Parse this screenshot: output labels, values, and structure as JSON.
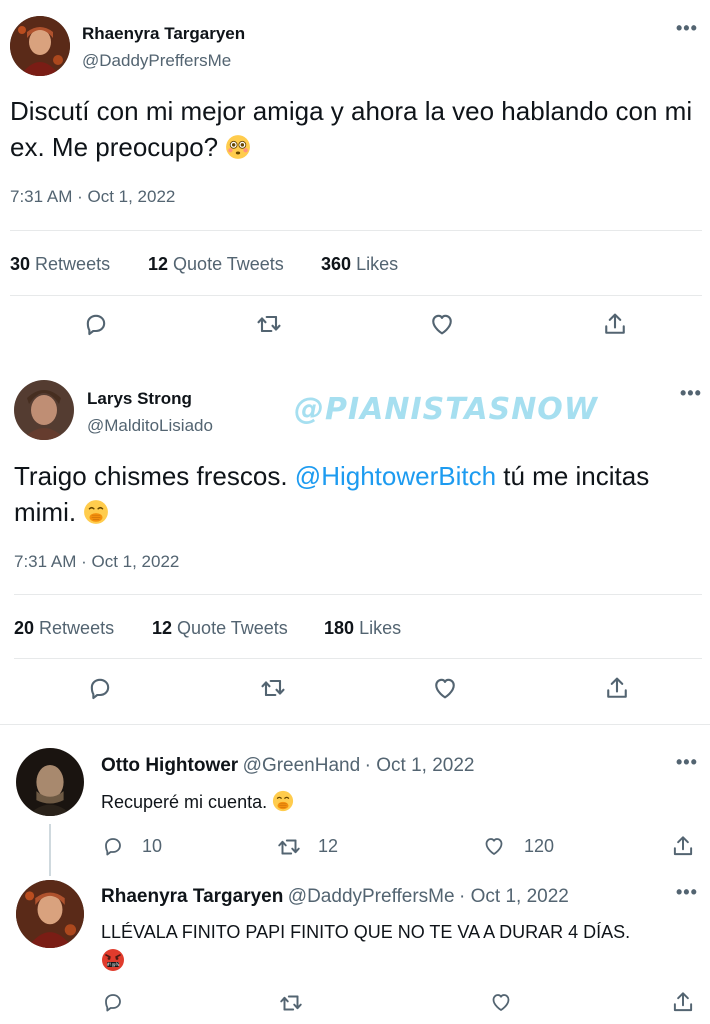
{
  "main_tweet": {
    "name": "Rhaenyra Targaryen",
    "handle": "@DaddyPreffersMe",
    "text": "Discutí con mi mejor amiga y ahora la veo hablando con mi ex. Me preocupo?",
    "emoji": "flushed-face",
    "timestamp": "7:31 AM · Oct 1, 2022",
    "stats": {
      "retweets_count": "30",
      "retweets_label": "Retweets",
      "quotes_count": "12",
      "quotes_label": "Quote Tweets",
      "likes_count": "360",
      "likes_label": "Likes"
    }
  },
  "quote_tweet": {
    "name": "Larys Strong",
    "handle": "@MalditoLisiado",
    "text_before": "Traigo chismes frescos. ",
    "mention": "@HightowerBitch",
    "text_after": " tú me incitas mimi.",
    "emoji": "face-with-hand-over-mouth",
    "timestamp": "7:31 AM · Oct 1, 2022",
    "stats": {
      "retweets_count": "20",
      "retweets_label": "Retweets",
      "quotes_count": "12",
      "quotes_label": "Quote Tweets",
      "likes_count": "180",
      "likes_label": "Likes"
    }
  },
  "watermark": "@PIANISTASNOW",
  "replies": [
    {
      "name": "Otto Hightower",
      "handle": "@GreenHand",
      "date": "· Oct 1, 2022",
      "text": "Recuperé mi cuenta.",
      "emoji": "face-with-hand-over-mouth",
      "reply_count": "10",
      "retweet_count": "12",
      "like_count": "120"
    },
    {
      "name": "Rhaenyra Targaryen",
      "handle": "@DaddyPreffersMe",
      "date": "· Oct 1, 2022",
      "text": "LLÉVALA FINITO PAPI FINITO QUE NO TE VA A DURAR 4 DÍAS.",
      "emoji": "face-with-symbols-on-mouth"
    }
  ],
  "icons": [
    "reply-icon",
    "retweet-icon",
    "like-icon",
    "share-icon",
    "more-icon"
  ],
  "colors": {
    "link": "#1d9bf0",
    "secondary_text": "#536471",
    "divider": "#e7e9ea",
    "watermark": "#a6dff0"
  }
}
